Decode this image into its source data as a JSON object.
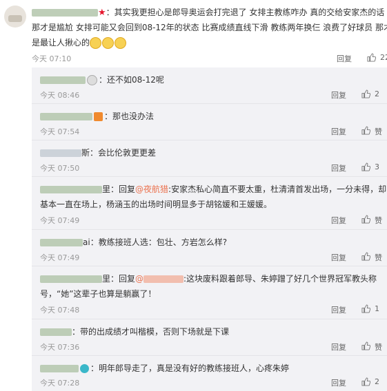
{
  "main_comment": {
    "line1": "：其实我更担心是郎导奥运会打完退了 女排主教练咋办 真的交给安家杰的话",
    "line2": "那才是尴尬 女排可能又会回到08-12年的状态 比赛成绩直线下滑 教练两年换仨 浪费了好球员 那才",
    "line3": "是最让人揪心的",
    "time": "今天 07:10",
    "reply_label": "回复",
    "likes": "22"
  },
  "replies": [
    {
      "text": "：还不如08-12呢",
      "time": "今天 08:46",
      "reply_label": "回复",
      "likes": "2"
    },
    {
      "text": "：那也没办法",
      "time": "今天 07:54",
      "reply_label": "回复",
      "likes": "赞"
    },
    {
      "text": "斯：会比伦敦更更差",
      "time": "今天 07:50",
      "reply_label": "回复",
      "likes": "3"
    },
    {
      "text_a": "里：回复",
      "mention": "@夜航猎",
      "text_b": ":安家杰私心简直不要太重，杜清清首发出场，一分未得，却",
      "text_c": "基本一直在场上，杨涵玉的出场时间明显多于胡铭媛和王媛媛。",
      "time": "今天 07:49",
      "reply_label": "回复",
      "likes": "赞"
    },
    {
      "text": "ai：教练接班人选：包壮、方岩怎么样?",
      "time": "今天 07:49",
      "reply_label": "回复",
      "likes": "赞"
    },
    {
      "text_a": "里：回复",
      "mention": "@",
      "text_b": ":这块废料跟着郎导、朱婷蹭了好几个世界冠军教头称",
      "text_c": "号，“她”这辈子也算是躺赢了！",
      "time": "今天 07:48",
      "reply_label": "回复",
      "likes": "1"
    },
    {
      "text": "：带的出成绩才叫楷模，否则下场就是下课",
      "time": "今天 07:36",
      "reply_label": "回复",
      "likes": "赞"
    },
    {
      "text": "：明年郎导走了，真是没有好的教练接班人，心疼朱婷",
      "time": "今天 07:28",
      "reply_label": "回复",
      "likes": "2"
    }
  ],
  "colors": {
    "username": "#5aa02c",
    "mention": "#eb7350",
    "panel_bg": "#f2f2f5"
  },
  "icons": [
    "thumbs-up-icon",
    "star-icon",
    "emoji-icon",
    "medal-icon"
  ]
}
